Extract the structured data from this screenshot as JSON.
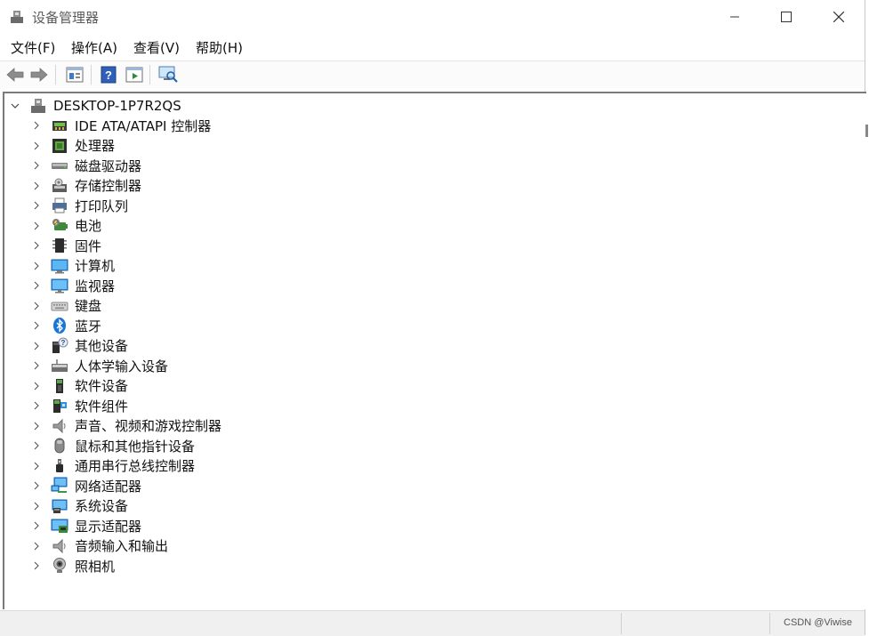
{
  "window": {
    "title": "设备管理器",
    "icon": "device-manager-icon",
    "controls": {
      "minimize": "minimize-icon",
      "maximize": "maximize-icon",
      "close": "close-icon"
    }
  },
  "menu": {
    "items": [
      {
        "label": "文件(F)"
      },
      {
        "label": "操作(A)"
      },
      {
        "label": "查看(V)"
      },
      {
        "label": "帮助(H)"
      }
    ]
  },
  "toolbar": {
    "buttons": [
      "back-arrow-icon",
      "forward-arrow-icon",
      "properties-icon",
      "help-icon",
      "run-icon",
      "scan-hardware-icon"
    ]
  },
  "tree": {
    "root": {
      "label": "DESKTOP-1P7R2QS",
      "icon": "computer-tower-icon",
      "expanded": true
    },
    "items": [
      {
        "label": "IDE ATA/ATAPI 控制器",
        "icon": "ide-controller-icon"
      },
      {
        "label": "处理器",
        "icon": "processor-icon"
      },
      {
        "label": "磁盘驱动器",
        "icon": "disk-drive-icon"
      },
      {
        "label": "存储控制器",
        "icon": "storage-controller-icon"
      },
      {
        "label": "打印队列",
        "icon": "printer-icon"
      },
      {
        "label": "电池",
        "icon": "battery-icon"
      },
      {
        "label": "固件",
        "icon": "firmware-icon"
      },
      {
        "label": "计算机",
        "icon": "computer-monitor-icon"
      },
      {
        "label": "监视器",
        "icon": "monitor-icon"
      },
      {
        "label": "键盘",
        "icon": "keyboard-icon"
      },
      {
        "label": "蓝牙",
        "icon": "bluetooth-icon"
      },
      {
        "label": "其他设备",
        "icon": "unknown-device-icon"
      },
      {
        "label": "人体学输入设备",
        "icon": "hid-icon"
      },
      {
        "label": "软件设备",
        "icon": "software-device-icon"
      },
      {
        "label": "软件组件",
        "icon": "software-component-icon"
      },
      {
        "label": "声音、视频和游戏控制器",
        "icon": "speaker-icon"
      },
      {
        "label": "鼠标和其他指针设备",
        "icon": "mouse-icon"
      },
      {
        "label": "通用串行总线控制器",
        "icon": "usb-icon"
      },
      {
        "label": "网络适配器",
        "icon": "network-adapter-icon"
      },
      {
        "label": "系统设备",
        "icon": "system-device-icon"
      },
      {
        "label": "显示适配器",
        "icon": "display-adapter-icon"
      },
      {
        "label": "音频输入和输出",
        "icon": "audio-io-icon"
      },
      {
        "label": "照相机",
        "icon": "camera-icon"
      }
    ]
  },
  "statusbar": {
    "watermark": "CSDN @Viwise"
  }
}
